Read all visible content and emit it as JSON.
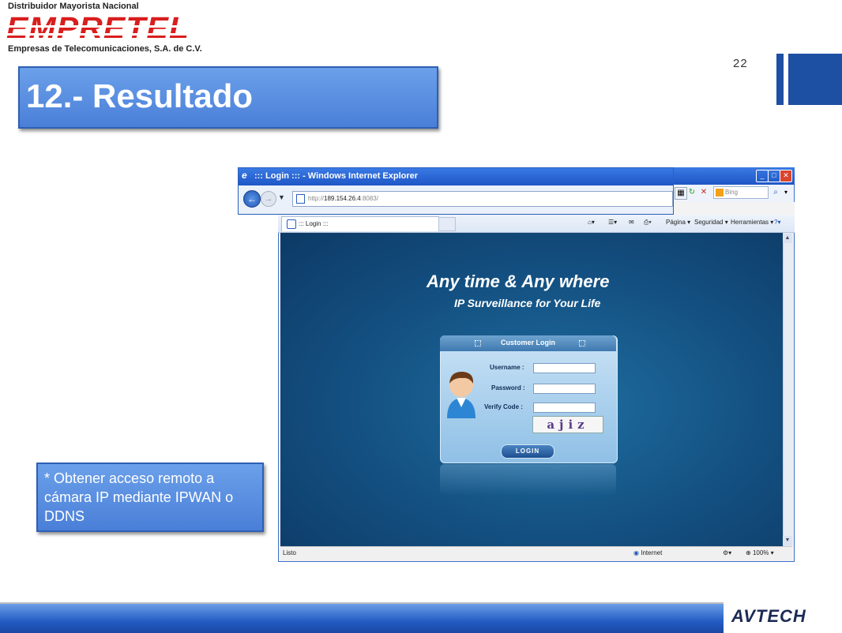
{
  "slide": {
    "page_number": "22",
    "title": "12.- Resultado",
    "note": "* Obtener acceso remoto a cámara IP mediante IPWAN o DDNS"
  },
  "branding": {
    "tagline_top": "Distribuidor Mayorista Nacional",
    "company_logo": "EMPRETEL",
    "tagline_bottom": "Empresas de Telecomunicaciones, S.A. de C.V.",
    "partner_logo": "AVTECH",
    "accent": "#1d4fa3",
    "logo_red": "#d91e1e"
  },
  "browser": {
    "window_title": "::: Login ::: - Windows Internet Explorer",
    "address": {
      "scheme": "http://",
      "host": "189.154.26.4",
      "port": ":8083/"
    },
    "search_placeholder": "Bing",
    "tab_label": "::: Login :::",
    "commands": {
      "page": "Página",
      "security": "Seguridad",
      "tools": "Herramientas"
    },
    "status": {
      "left": "Listo",
      "zone": "Internet",
      "zoom": "100%"
    },
    "icons": [
      "back-arrow-icon",
      "forward-arrow-icon",
      "refresh-icon",
      "stop-icon",
      "home-icon",
      "feeds-icon",
      "mail-icon",
      "print-icon",
      "help-icon",
      "globe-icon"
    ]
  },
  "web_page": {
    "hero_title": "Any time & Any where",
    "hero_subtitle": "IP Surveillance for Your Life",
    "login": {
      "header": "Customer Login",
      "username_label": "Username :",
      "password_label": "Password :",
      "verify_label": "Verify Code :",
      "captcha_text": "ajiz",
      "login_button": "LOGIN"
    }
  }
}
